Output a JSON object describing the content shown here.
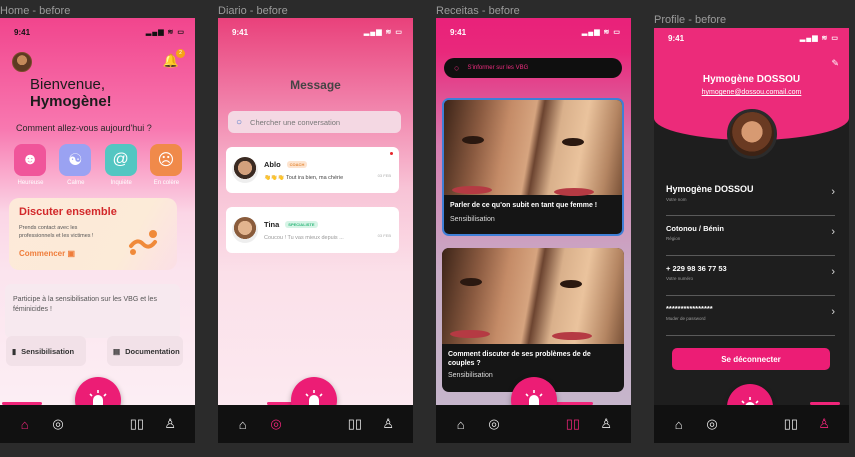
{
  "frames": {
    "home": "Home - before",
    "diario": "Diario - before",
    "receitas": "Receitas - before",
    "profile": "Profile - before"
  },
  "status": {
    "time": "9:41"
  },
  "home": {
    "welcome_line1": "Bienvenue,",
    "welcome_line2": "Hymogène!",
    "question": "Comment allez-vous aujourd'hui ?",
    "moods": [
      {
        "label": "Heureuse",
        "color": "#f0559a",
        "icon": "happy-face-icon"
      },
      {
        "label": "Calme",
        "color": "#9aa2f2",
        "icon": "yin-yang-icon"
      },
      {
        "label": "Inquiète",
        "color": "#53c6c2",
        "icon": "spiral-icon"
      },
      {
        "label": "En colère",
        "color": "#f08a4a",
        "icon": "angry-face-icon"
      }
    ],
    "bell_badge": "2",
    "chat_card": {
      "title": "Discuter ensemble",
      "text": "Prends contact avec les professionnels et les victimes !",
      "cta": "Commencer"
    },
    "info_text": "Participe à la sensibilisation sur les VBG et les féminicides !",
    "buttons": {
      "sensibilisation": "Sensibilisation",
      "documentation": "Documentation"
    }
  },
  "diario": {
    "title": "Message",
    "search_placeholder": "Chercher une conversation",
    "conversations": [
      {
        "name": "Ablo",
        "tag": "COACH",
        "preview": "👋👋👋 Tout ira bien, ma chérie",
        "date": "03 FEB"
      },
      {
        "name": "Tina",
        "tag": "SPECIALISTE",
        "preview": "Coucou ! Tu vas mieux depuis ...",
        "date": "03 FEB"
      }
    ]
  },
  "receitas": {
    "search_placeholder": "S'informer sur les VBG",
    "articles": [
      {
        "title": "Parler de ce qu'on subit en tant que femme !",
        "category": "Sensibilisation"
      },
      {
        "title": "Comment discuter de ses problèmes de de couples ?",
        "category": "Sensibilisation"
      }
    ]
  },
  "profile": {
    "name": "Hymogène DOSSOU",
    "email": "hymogene@dossou.comail.com",
    "rows": [
      {
        "value": "Hymogène DOSSOU",
        "key": "Votre nom"
      },
      {
        "value": "Cotonou / Bénin",
        "key": "Région"
      },
      {
        "value": "+ 229 98 36 77 53",
        "key": "Votre numéro"
      },
      {
        "value": "****************",
        "key": "Muder de password"
      }
    ],
    "logout": "Se déconnecter"
  },
  "colors": {
    "accent": "#ec1d75",
    "nav": "#111111"
  }
}
